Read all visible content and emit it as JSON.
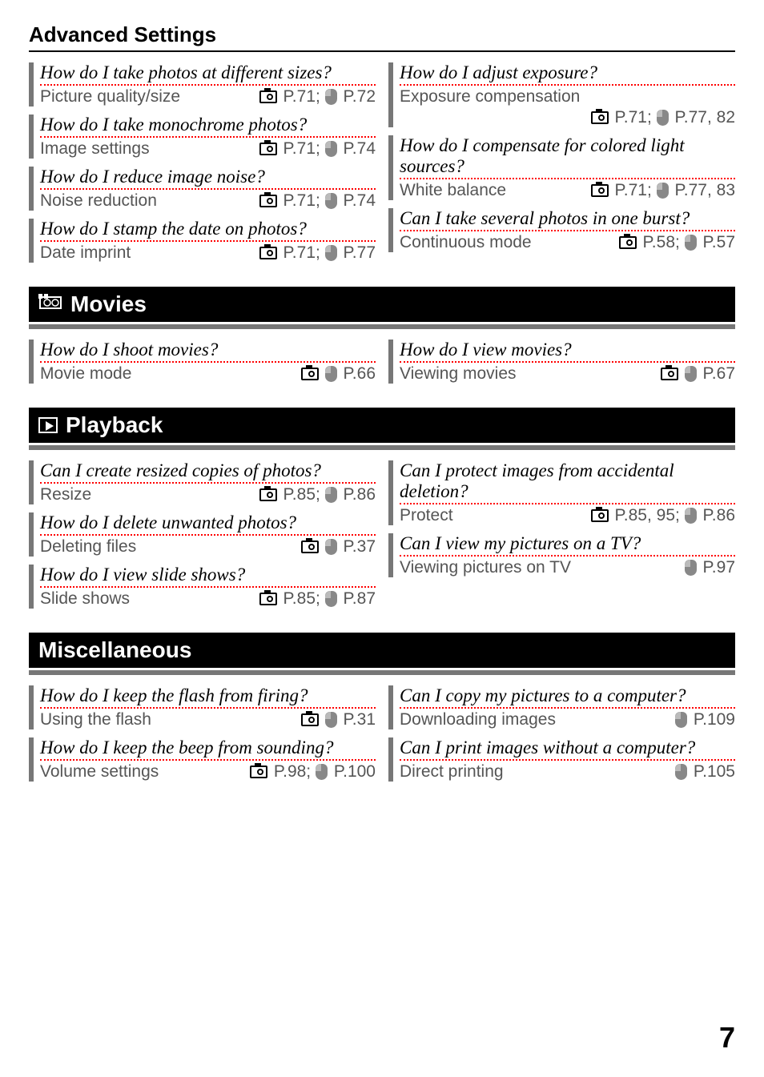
{
  "headings": {
    "advanced": "Advanced Settings",
    "movies": "Movies",
    "playback": "Playback",
    "misc": "Miscellaneous"
  },
  "advanced": {
    "left": [
      {
        "q": "How do I take photos at different sizes?",
        "a": "Picture quality/size",
        "r": "P.71;",
        "r2": "P.72"
      },
      {
        "q": "How do I take monochrome photos?",
        "a": "Image settings",
        "r": "P.71;",
        "r2": "P.74"
      },
      {
        "q": "How do I reduce image noise?",
        "a": "Noise reduction",
        "r": "P.71;",
        "r2": "P.74"
      },
      {
        "q": "How do I stamp the date on photos?",
        "a": "Date imprint",
        "r": "P.71;",
        "r2": "P.77"
      }
    ],
    "right": [
      {
        "q": "How do I adjust exposure?",
        "a": "Exposure compensation",
        "r": "P.71;",
        "r2": "P.77, 82",
        "wrap": true
      },
      {
        "q": "How do I compensate for colored light sources?",
        "a": "White balance",
        "r": "P.71;",
        "r2": "P.77, 83"
      },
      {
        "q": "Can I take several photos in one burst?",
        "a": "Continuous mode",
        "r": "P.58;",
        "r2": "P.57"
      }
    ]
  },
  "movies": {
    "left": [
      {
        "q": "How do I shoot movies?",
        "a": "Movie mode",
        "r": "",
        "r2": "P.66",
        "both": true
      }
    ],
    "right": [
      {
        "q": "How do I view movies?",
        "a": "Viewing movies",
        "r": "",
        "r2": "P.67",
        "both": true
      }
    ]
  },
  "playback": {
    "left": [
      {
        "q": "Can I create resized copies of photos?",
        "a": "Resize",
        "r": "P.85;",
        "r2": "P.86"
      },
      {
        "q": "How do I delete unwanted photos?",
        "a": "Deleting files",
        "r": "",
        "r2": "P.37",
        "both": true
      },
      {
        "q": "How do I view slide shows?",
        "a": "Slide shows",
        "r": "P.85;",
        "r2": "P.87"
      }
    ],
    "right": [
      {
        "q": "Can I protect images from accidental deletion?",
        "a": "Protect",
        "r": "P.85, 95;",
        "r2": "P.86"
      },
      {
        "q": "Can I view my pictures on a TV?",
        "a": "Viewing pictures on TV",
        "r": "",
        "r2": "P.97",
        "mouseOnly": true
      }
    ]
  },
  "misc": {
    "left": [
      {
        "q": "How do I keep the flash from firing?",
        "a": "Using the flash",
        "r": "",
        "r2": "P.31",
        "both": true
      },
      {
        "q": "How do I keep the beep from sounding?",
        "a": "Volume settings",
        "r": "P.98;",
        "r2": "P.100"
      }
    ],
    "right": [
      {
        "q": "Can I copy my pictures to a computer?",
        "a": "Downloading images",
        "r": "",
        "r2": "P.109",
        "mouseOnly": true
      },
      {
        "q": "Can I print images without a computer?",
        "a": "Direct printing",
        "r": "",
        "r2": "P.105",
        "mouseOnly": true
      }
    ]
  },
  "pageNumber": "7"
}
